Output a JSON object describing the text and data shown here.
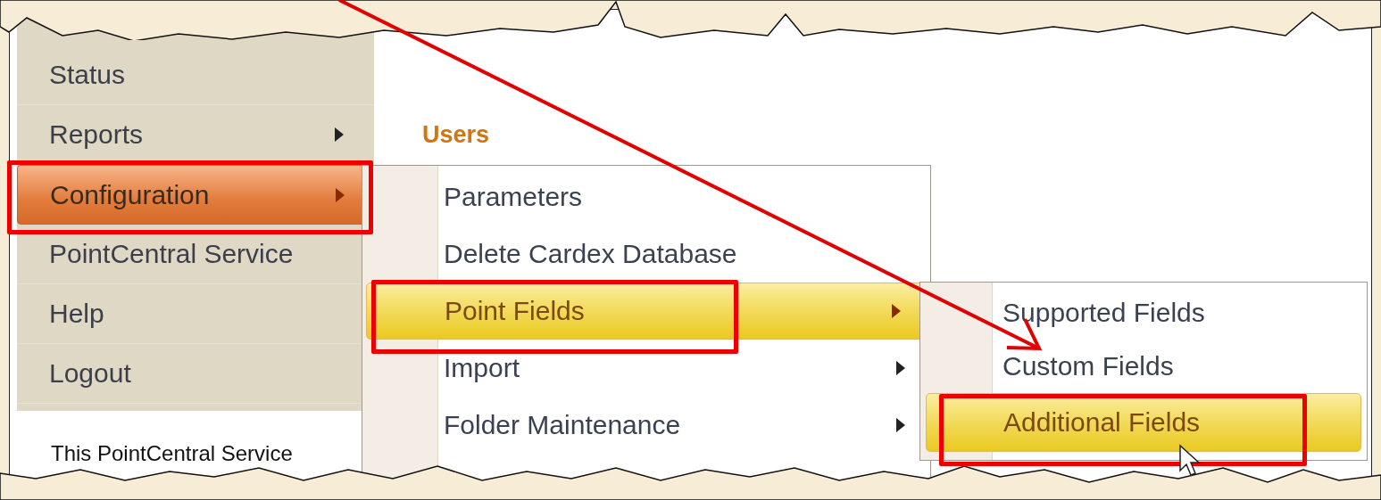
{
  "nav": {
    "items": [
      {
        "label": "Status",
        "selected": false,
        "has_submenu": false
      },
      {
        "label": "Reports",
        "selected": false,
        "has_submenu": true
      },
      {
        "label": "Configuration",
        "selected": true,
        "has_submenu": true
      },
      {
        "label": "PointCentral Service",
        "selected": false,
        "has_submenu": false
      },
      {
        "label": "Help",
        "selected": false,
        "has_submenu": false
      },
      {
        "label": "Logout",
        "selected": false,
        "has_submenu": false
      }
    ]
  },
  "content": {
    "heading": "Users",
    "text": "This PointCentral Service"
  },
  "configuration_menu": {
    "items": [
      {
        "label": "Parameters",
        "selected": false,
        "has_submenu": false
      },
      {
        "label": "Delete Cardex Database",
        "selected": false,
        "has_submenu": false
      },
      {
        "label": "Point Fields",
        "selected": true,
        "has_submenu": true
      },
      {
        "label": "Import",
        "selected": false,
        "has_submenu": true
      },
      {
        "label": "Folder Maintenance",
        "selected": false,
        "has_submenu": true
      }
    ]
  },
  "point_fields_menu": {
    "items": [
      {
        "label": "Supported Fields",
        "selected": false,
        "has_submenu": false
      },
      {
        "label": "Custom Fields",
        "selected": false,
        "has_submenu": false
      },
      {
        "label": "Additional Fields",
        "selected": true,
        "has_submenu": false
      }
    ]
  }
}
